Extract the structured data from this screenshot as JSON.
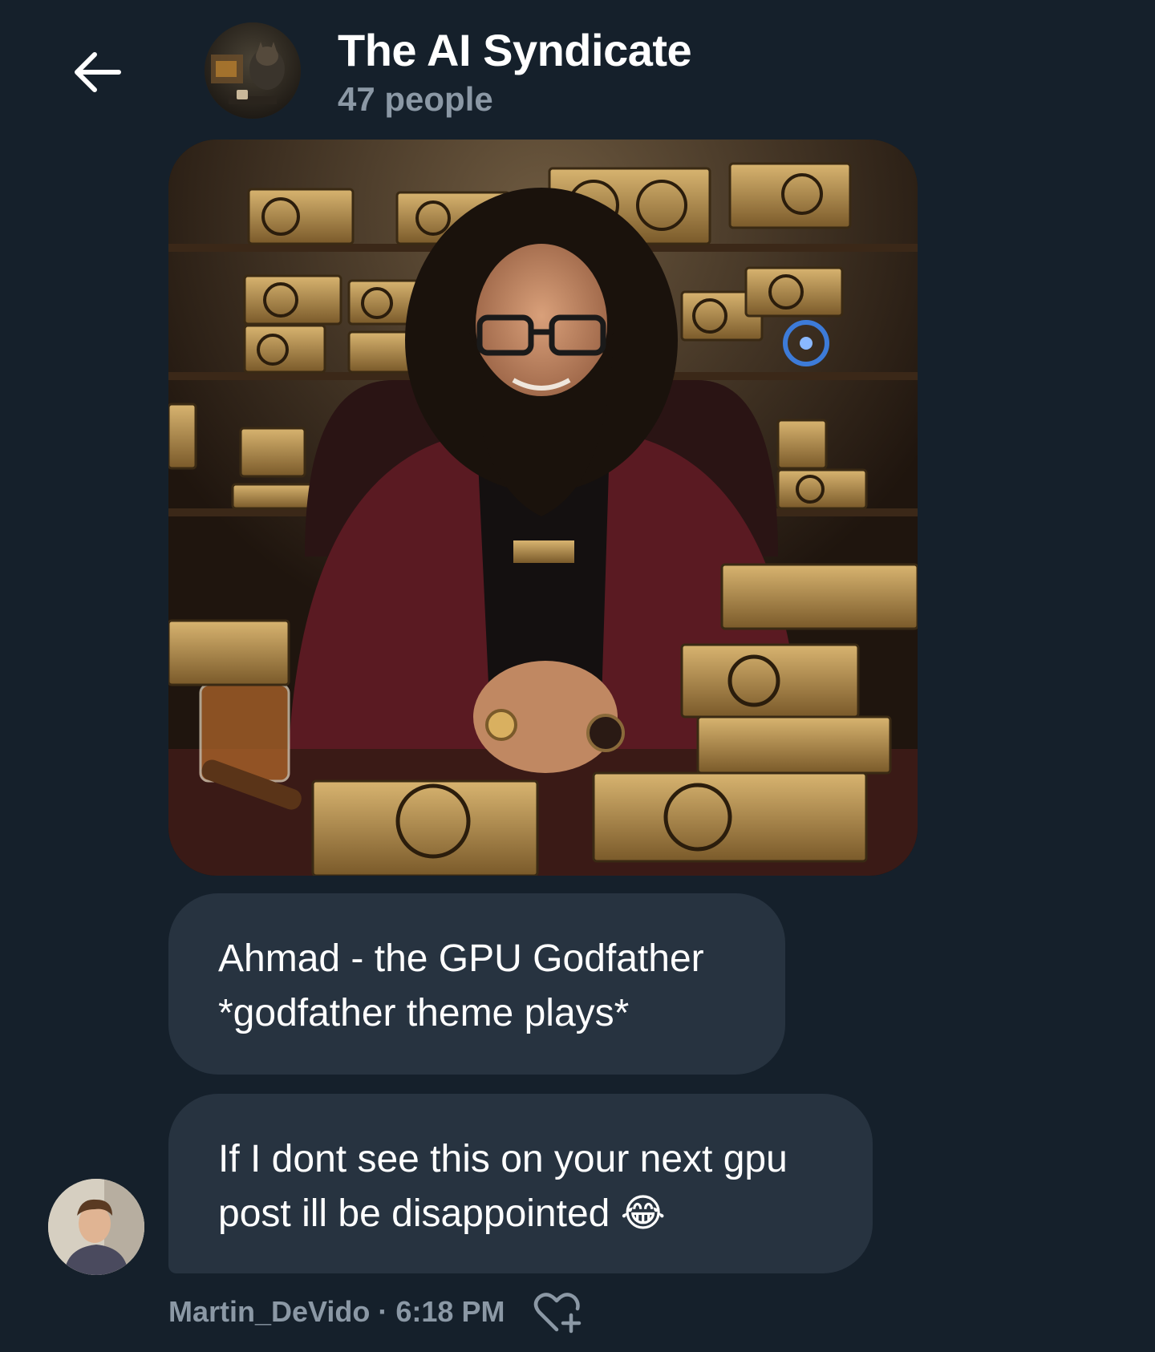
{
  "header": {
    "back_icon": "arrow-left-icon",
    "title": "The AI Syndicate",
    "subtitle": "47 people"
  },
  "messages": [
    {
      "type": "image",
      "description_icon": "generated-image"
    },
    {
      "type": "text",
      "lines": [
        "Ahmad - the GPU Godfather",
        "*godfather theme plays*"
      ]
    },
    {
      "type": "text",
      "lines": [
        "If I dont see this on your next gpu",
        "post ill be disappointed 😂"
      ]
    }
  ],
  "meta": {
    "sender": "Martin_DeVido",
    "separator": "·",
    "time": "6:18 PM",
    "react_icon": "heart-plus-icon"
  },
  "colors": {
    "background": "#15202b",
    "bubble": "#273340",
    "muted_text": "#8b98a5",
    "text": "#ffffff"
  }
}
